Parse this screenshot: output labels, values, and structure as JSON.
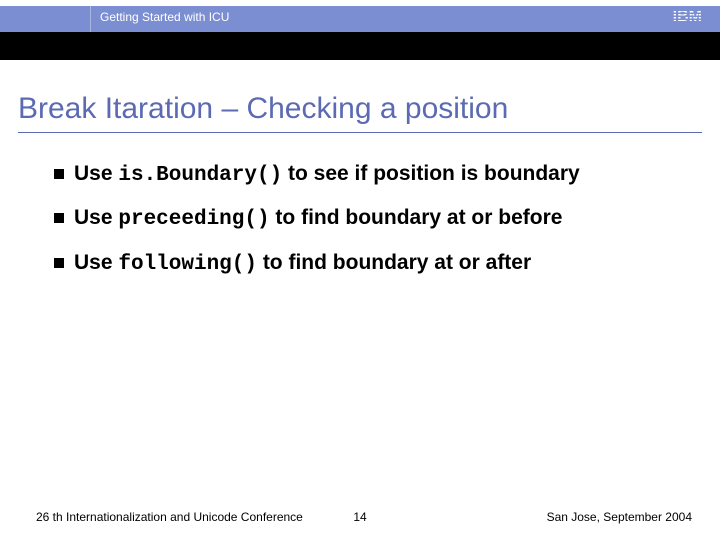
{
  "header": {
    "session_title": "Getting Started with ICU",
    "logo_text": "IBM"
  },
  "title": "Break Itaration – Checking a position",
  "bullets": [
    {
      "pre": "Use ",
      "code": "is.Boundary()",
      "post": " to see if position is boundary"
    },
    {
      "pre": "Use ",
      "code": "preceeding()",
      "post": " to find boundary at or before"
    },
    {
      "pre": "Use ",
      "code": "following()",
      "post": " to find boundary at or after"
    }
  ],
  "footer": {
    "left": "26 th Internationalization and Unicode Conference",
    "page": "14",
    "right": "San Jose, September 2004"
  }
}
